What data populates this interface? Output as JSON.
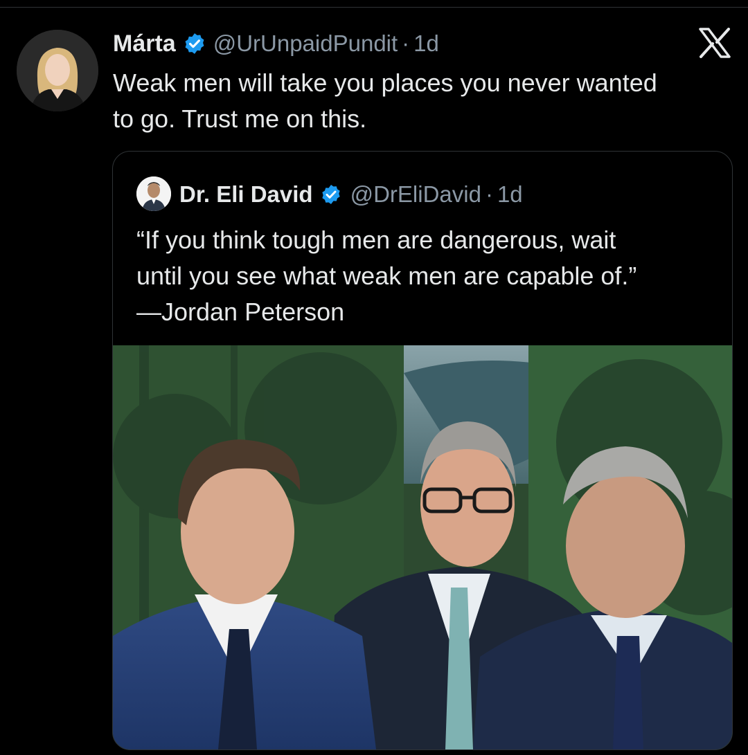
{
  "tweet": {
    "author_name": "Márta",
    "handle": "@UrUnpaidPundit",
    "separator": "·",
    "time": "1d",
    "text_lines": [
      "Weak men will take you places you never wanted",
      "to go. Trust me on this."
    ],
    "verified_icon": "verified-badge-icon",
    "brand_icon": "x-logo-icon"
  },
  "quote": {
    "author_name": "Dr. Eli David",
    "handle": "@DrEliDavid",
    "separator": "·",
    "time": "1d",
    "text_lines": [
      "“If you think tough men are dangerous, wait",
      "until you see what weak men are capable of.”",
      "—Jordan Peterson"
    ],
    "verified_icon": "verified-badge-icon"
  },
  "colors": {
    "background": "#000000",
    "text": "#e7e9ea",
    "muted": "#8b98a5",
    "verified": "#1d9bf0",
    "border": "#2f3336"
  }
}
